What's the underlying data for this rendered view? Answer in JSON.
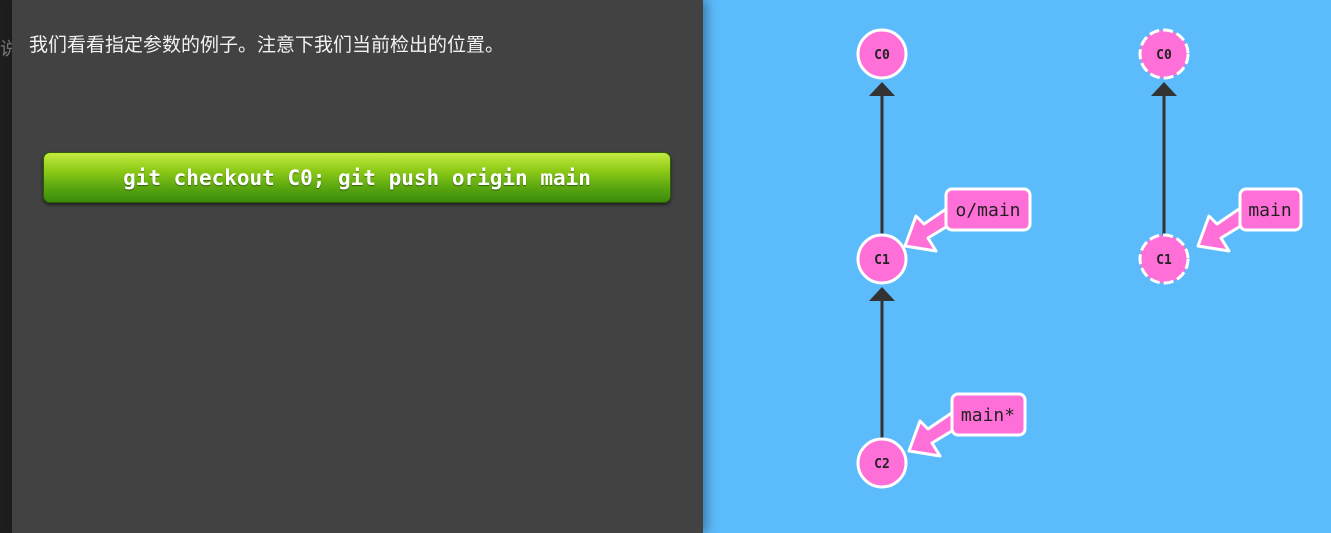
{
  "panel": {
    "edge_glyph": "说",
    "text": "我们看看指定参数的例子。注意下我们当前检出的位置。",
    "command": "git checkout C0; git push origin main"
  },
  "colors": {
    "background": "#5cbbfb",
    "panel": "#424242",
    "commit_fill": "#ff6fd8",
    "branch_fill": "#ff6fd8",
    "edge": "#333333"
  },
  "local_repo": {
    "commits": [
      {
        "label": "C0"
      },
      {
        "label": "C1"
      },
      {
        "label": "C2"
      }
    ],
    "branches": [
      {
        "label": "o/main"
      },
      {
        "label": "main*"
      }
    ]
  },
  "remote_repo": {
    "commits": [
      {
        "label": "C0"
      },
      {
        "label": "C1"
      }
    ],
    "branches": [
      {
        "label": "main"
      }
    ]
  }
}
